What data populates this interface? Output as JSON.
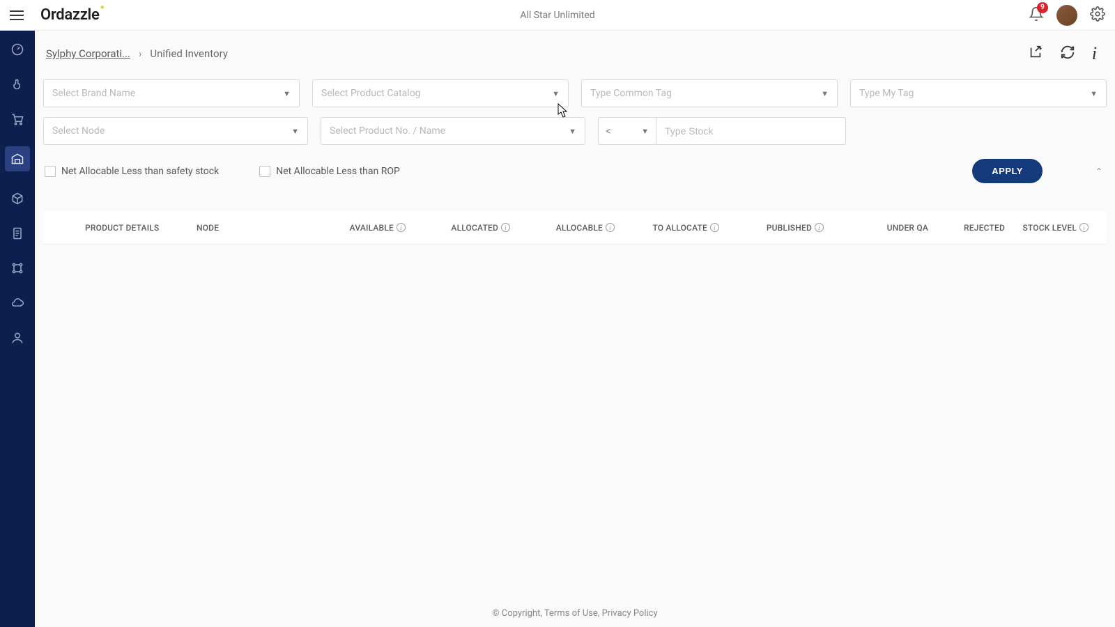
{
  "header": {
    "brand": "Ordazzle",
    "tenant": "All Star Unlimited",
    "notification_count": "9"
  },
  "breadcrumb": {
    "parent": "Sylphy Corporati...",
    "current": "Unified Inventory"
  },
  "filters": {
    "brand_name_ph": "Select Brand Name",
    "product_catalog_ph": "Select Product Catalog",
    "common_tag_ph": "Type Common Tag",
    "my_tag_ph": "Type My Tag",
    "node_ph": "Select Node",
    "product_no_ph": "Select Product No. / Name",
    "stock_op": "<",
    "stock_ph": "Type Stock",
    "chk_safety": "Net Allocable Less than safety stock",
    "chk_rop": "Net Allocable Less than ROP",
    "apply": "APPLY"
  },
  "table": {
    "cols": {
      "product_details": "PRODUCT DETAILS",
      "node": "NODE",
      "available": "AVAILABLE",
      "allocated": "ALLOCATED",
      "allocable": "ALLOCABLE",
      "to_allocate": "TO ALLOCATE",
      "published": "PUBLISHED",
      "under_qa": "UNDER QA",
      "rejected": "REJECTED",
      "stock_level": "STOCK LEVEL"
    }
  },
  "footer": {
    "text": "© Copyright, Terms of Use, Privacy Policy"
  }
}
